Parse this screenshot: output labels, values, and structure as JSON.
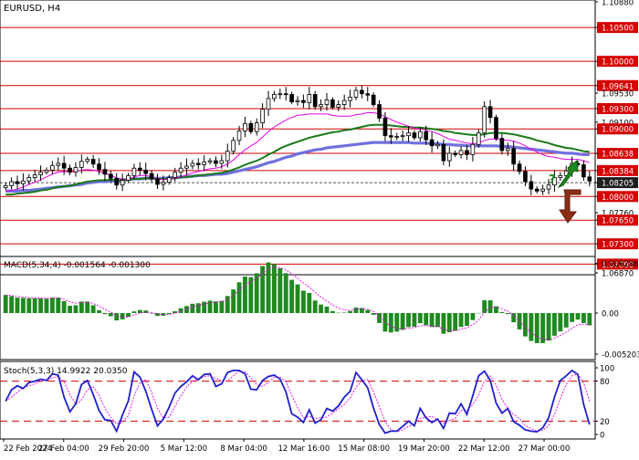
{
  "chart_data": {
    "type": "candlestick",
    "symbol_label": "EURUSD, H4",
    "price_axis": {
      "min": 1.0687,
      "max": 1.1088,
      "tick_labels": [
        "1.10880",
        "1.10500",
        "1.10000",
        "1.09641",
        "1.09530",
        "1.09300",
        "1.09100",
        "1.09000",
        "1.08638",
        "1.08384",
        "1.08205",
        "1.08000",
        "1.07760",
        "1.07650",
        "1.07300",
        "1.07000",
        "1.06870"
      ],
      "tick_values": [
        1.1088,
        1.105,
        1.1,
        1.09641,
        1.0953,
        1.093,
        1.091,
        1.09,
        1.08638,
        1.08384,
        1.08205,
        1.08,
        1.0776,
        1.0765,
        1.073,
        1.07,
        1.0687
      ],
      "highlight_colors": {
        "1.10500": "#d40000",
        "1.10000": "#d40000",
        "1.09641": "#d40000",
        "1.09300": "#d40000",
        "1.09000": "#d40000",
        "1.08638": "#d40000",
        "1.08384": "#d40000",
        "1.08205": "#1e1e1e",
        "1.08000": "#d40000",
        "1.07650": "#d40000",
        "1.07300": "#d40000",
        "1.07000": "#d40000"
      }
    },
    "horizontal_levels": [
      1.105,
      1.1,
      1.09641,
      1.093,
      1.09,
      1.08638,
      1.08384,
      1.08,
      1.0765,
      1.073,
      1.07
    ],
    "current_price": 1.08205,
    "time_labels": [
      "22 Feb 2024",
      "27 Feb 04:00",
      "29 Feb 20:00",
      "5 Mar 12:00",
      "8 Mar 04:00",
      "12 Mar 16:00",
      "15 Mar 08:00",
      "19 Mar 20:00",
      "22 Mar 12:00",
      "27 Mar 00:00"
    ],
    "closes": [
      1.0816,
      1.0822,
      1.0819,
      1.0823,
      1.0828,
      1.0832,
      1.0836,
      1.0839,
      1.0846,
      1.0849,
      1.0842,
      1.0836,
      1.0843,
      1.0852,
      1.0855,
      1.0848,
      1.084,
      1.0833,
      1.0827,
      1.0817,
      1.0824,
      1.0831,
      1.0842,
      1.0839,
      1.0834,
      1.0826,
      1.0818,
      1.0821,
      1.0828,
      1.0836,
      1.0842,
      1.0845,
      1.0849,
      1.0847,
      1.0851,
      1.0853,
      1.0849,
      1.0853,
      1.0867,
      1.0883,
      1.0897,
      1.0908,
      1.0896,
      1.0909,
      1.0929,
      1.0945,
      1.0951,
      1.0952,
      1.0951,
      1.094,
      1.0942,
      1.0939,
      1.0951,
      1.0933,
      1.0936,
      1.0943,
      1.0932,
      1.0936,
      1.0942,
      1.0947,
      1.0957,
      1.0952,
      1.095,
      1.0936,
      1.0916,
      1.089,
      1.0888,
      1.0889,
      1.089,
      1.0894,
      1.0887,
      1.0896,
      1.0884,
      1.0875,
      1.0877,
      1.0853,
      1.0864,
      1.0862,
      1.0868,
      1.0862,
      1.0877,
      1.0894,
      1.0933,
      1.0917,
      1.0886,
      1.0868,
      1.0871,
      1.0848,
      1.0837,
      1.0822,
      1.0811,
      1.0808,
      1.0811,
      1.0817,
      1.0828,
      1.0831,
      1.0838,
      1.0849,
      1.0847,
      1.0829,
      1.0823
    ],
    "indicator_lines": {
      "magenta": [
        1.0808,
        1.0809,
        1.0811,
        1.0814,
        1.0818,
        1.0821,
        1.0825,
        1.0829,
        1.0833,
        1.0836,
        1.0837,
        1.0836,
        1.0837,
        1.0839,
        1.084,
        1.0839,
        1.0837,
        1.0834,
        1.0832,
        1.0827,
        1.0826,
        1.0826,
        1.0829,
        1.0831,
        1.0831,
        1.0829,
        1.0826,
        1.0825,
        1.0825,
        1.0827,
        1.0829,
        1.0832,
        1.0835,
        1.0837,
        1.0839,
        1.0841,
        1.0842,
        1.0844,
        1.0848,
        1.0854,
        1.0862,
        1.0869,
        1.0875,
        1.088,
        1.0888,
        1.0896,
        1.0903,
        1.0908,
        1.0913,
        1.0917,
        1.092,
        1.0921,
        1.0922,
        1.0922,
        1.0922,
        1.0922,
        1.092,
        1.0919,
        1.0919,
        1.0919,
        1.0921,
        1.0922,
        1.0924,
        1.0924,
        1.0922,
        1.0918,
        1.0914,
        1.091,
        1.0907,
        1.0904,
        1.0901,
        1.09,
        1.0898,
        1.0896,
        1.0893,
        1.0889,
        1.0885,
        1.0883,
        1.0881,
        1.0879,
        1.0878,
        1.0879,
        1.0883,
        1.0885,
        1.0885,
        1.0884,
        1.0883,
        1.0882,
        1.0879,
        1.0875,
        1.087,
        1.0866,
        1.0862,
        1.0859,
        1.0858,
        1.0856,
        1.0855,
        1.0855,
        1.0855,
        1.0853,
        1.085
      ],
      "green": [
        1.0803,
        1.0803,
        1.0804,
        1.0805,
        1.0806,
        1.0807,
        1.0809,
        1.081,
        1.0812,
        1.0814,
        1.0815,
        1.0816,
        1.0818,
        1.082,
        1.0822,
        1.0823,
        1.0824,
        1.0824,
        1.0825,
        1.0824,
        1.0824,
        1.0825,
        1.0826,
        1.0826,
        1.0827,
        1.0827,
        1.0826,
        1.0826,
        1.0826,
        1.0827,
        1.0828,
        1.0829,
        1.083,
        1.0831,
        1.0832,
        1.0833,
        1.0834,
        1.0835,
        1.0837,
        1.084,
        1.0843,
        1.0847,
        1.085,
        1.0853,
        1.0857,
        1.0862,
        1.0866,
        1.0871,
        1.0875,
        1.0878,
        1.0881,
        1.0884,
        1.0887,
        1.0889,
        1.0891,
        1.0893,
        1.0895,
        1.0896,
        1.0898,
        1.0899,
        1.0901,
        1.0903,
        1.0905,
        1.0906,
        1.0906,
        1.0906,
        1.0905,
        1.0904,
        1.0903,
        1.0903,
        1.0902,
        1.0902,
        1.0901,
        1.09,
        1.0899,
        1.0897,
        1.0896,
        1.0894,
        1.0893,
        1.0892,
        1.0891,
        1.0891,
        1.0892,
        1.0894,
        1.0894,
        1.0894,
        1.0893,
        1.0892,
        1.089,
        1.0888,
        1.0886,
        1.0883,
        1.0881,
        1.0879,
        1.0876,
        1.0874,
        1.0872,
        1.0871,
        1.0869,
        1.0867,
        1.0866
      ],
      "blue": [
        1.0808,
        1.0808,
        1.0808,
        1.0809,
        1.0809,
        1.081,
        1.0811,
        1.0812,
        1.0813,
        1.0814,
        1.0815,
        1.0816,
        1.0817,
        1.0818,
        1.082,
        1.0821,
        1.0822,
        1.0822,
        1.0823,
        1.0823,
        1.0824,
        1.0825,
        1.0826,
        1.0826,
        1.0827,
        1.0827,
        1.0827,
        1.0827,
        1.0828,
        1.0828,
        1.0829,
        1.0829,
        1.083,
        1.0831,
        1.0831,
        1.0832,
        1.0833,
        1.0833,
        1.0834,
        1.0836,
        1.0838,
        1.084,
        1.0842,
        1.0844,
        1.0847,
        1.085,
        1.0852,
        1.0855,
        1.0858,
        1.086,
        1.0863,
        1.0865,
        1.0867,
        1.0869,
        1.087,
        1.0872,
        1.0873,
        1.0874,
        1.0875,
        1.0876,
        1.0877,
        1.0878,
        1.0879,
        1.088,
        1.088,
        1.088,
        1.088,
        1.088,
        1.088,
        1.088,
        1.0879,
        1.0879,
        1.0879,
        1.0878,
        1.0878,
        1.0877,
        1.0877,
        1.0876,
        1.0876,
        1.0875,
        1.0875,
        1.0875,
        1.0875,
        1.0875,
        1.0875,
        1.0874,
        1.0874,
        1.0873,
        1.0872,
        1.0871,
        1.087,
        1.0869,
        1.0868,
        1.0867,
        1.0866,
        1.0865,
        1.0864,
        1.0864,
        1.0863,
        1.0862,
        1.0862
      ]
    },
    "macd": {
      "label": "MACD(5,34,4) -0.001564 -0.001300",
      "axis_labels": [
        "0.006286",
        "0.00",
        "-0.005203"
      ],
      "axis_values": [
        0.006286,
        0,
        -0.005203
      ],
      "histogram": [
        0.00229,
        0.00214,
        0.00196,
        0.00192,
        0.00187,
        0.00186,
        0.00186,
        0.00183,
        0.00196,
        0.00195,
        0.00151,
        0.00093,
        0.00099,
        0.00145,
        0.00146,
        0.00099,
        0.00035,
        -0.00014,
        -0.00041,
        -0.00093,
        -0.0008,
        -0.00048,
        0.00021,
        0.00039,
        0.00033,
        1e-05,
        -0.00037,
        -0.00034,
        -0.00012,
        0.00023,
        0.00061,
        0.00089,
        0.00118,
        0.00124,
        0.00143,
        0.00158,
        0.00148,
        0.00154,
        0.00216,
        0.00299,
        0.0039,
        0.00462,
        0.00456,
        0.00504,
        0.00596,
        0.00641,
        0.0062,
        0.00567,
        0.00505,
        0.00421,
        0.00363,
        0.00284,
        0.00255,
        0.00159,
        0.00108,
        0.00082,
        0.00025,
        4e-05,
        6e-05,
        0.00025,
        0.0007,
        0.00064,
        0.00038,
        -0.00022,
        -0.00126,
        -0.00235,
        -0.00245,
        -0.00235,
        -0.00213,
        -0.00178,
        -0.00173,
        -0.00128,
        -0.00153,
        -0.00177,
        -0.00177,
        -0.00262,
        -0.00243,
        -0.00225,
        -0.00176,
        -0.00162,
        -0.00089,
        1e-05,
        0.00162,
        0.00161,
        0.00086,
        0.00013,
        -0.00013,
        -0.00117,
        -0.00207,
        -0.00296,
        -0.00353,
        -0.00381,
        -0.00381,
        -0.00348,
        -0.00287,
        -0.00233,
        -0.00183,
        -0.00113,
        -0.00083,
        -0.00126,
        -0.00156
      ],
      "signal": [
        0.00229,
        0.00222,
        0.0021,
        0.00202,
        0.00196,
        0.00192,
        0.0019,
        0.00187,
        0.0019,
        0.00192,
        0.00175,
        0.00142,
        0.00125,
        0.00133,
        0.00138,
        0.00123,
        0.00088,
        0.00047,
        0.00012,
        -0.0003,
        -0.00051,
        -0.0005,
        -0.00022,
        0,
        0.00013,
        8e-05,
        -0.0001,
        -0.0002,
        -0.00017,
        -1e-05,
        0.00024,
        0.0005,
        0.00077,
        0.00096,
        0.00115,
        0.00132,
        0.00139,
        0.00145,
        0.00173,
        0.00223,
        0.0029,
        0.00359,
        0.00398,
        0.00441,
        0.00503,
        0.00558,
        0.00583,
        0.00577,
        0.00548,
        0.00497,
        0.00443,
        0.00379,
        0.0033,
        0.00262,
        0.002,
        0.00153,
        0.00102,
        0.00063,
        0.0004,
        0.00034,
        0.00048,
        0.00054,
        0.00048,
        0.0002,
        -0.00038,
        -0.00117,
        -0.00168,
        -0.00195,
        -0.00202,
        -0.00192,
        -0.00185,
        -0.00162,
        -0.00158,
        -0.00166,
        -0.0017,
        -0.00207,
        -0.00221,
        -0.00223,
        -0.00204,
        -0.00187,
        -0.00148,
        -0.00088,
        0.00012,
        0.00072,
        0.00077,
        0.00052,
        0.00026,
        -0.00031,
        -0.00101,
        -0.00179,
        -0.00249,
        -0.00302,
        -0.00334,
        -0.00339,
        -0.00318,
        -0.00284,
        -0.00243,
        -0.00191,
        -0.00148,
        -0.0014,
        -0.00146
      ]
    },
    "stochastic": {
      "label": "Stoch(5,3,3) 14.9922 20.0350",
      "axis_labels": [
        "100",
        "80",
        "20",
        "0"
      ],
      "axis_values": [
        100,
        80,
        20,
        0
      ],
      "main": [
        50,
        67,
        73,
        69,
        78,
        80,
        83,
        81,
        91,
        89,
        56,
        34,
        46,
        75,
        81,
        60,
        36,
        22,
        21,
        5,
        29,
        50,
        94,
        86,
        65,
        38,
        13,
        23,
        41,
        62,
        72,
        79,
        88,
        82,
        90,
        91,
        72,
        76,
        93,
        96,
        96,
        91,
        68,
        67,
        81,
        87,
        89,
        83,
        64,
        31,
        26,
        18,
        37,
        17,
        22,
        39,
        35,
        43,
        56,
        65,
        93,
        82,
        70,
        40,
        15,
        2,
        5,
        5,
        12,
        20,
        13,
        39,
        25,
        18,
        23,
        9,
        32,
        31,
        46,
        30,
        58,
        88,
        95,
        81,
        47,
        32,
        39,
        19,
        14,
        7,
        5,
        4,
        10,
        25,
        56,
        81,
        88,
        96,
        90,
        45,
        15
      ],
      "signal": [
        50,
        56,
        63,
        70,
        73,
        76,
        80,
        81,
        85,
        87,
        79,
        60,
        45,
        52,
        67,
        72,
        59,
        39,
        26,
        16,
        18,
        28,
        58,
        77,
        82,
        63,
        39,
        25,
        26,
        42,
        58,
        71,
        80,
        83,
        87,
        88,
        84,
        80,
        80,
        88,
        95,
        94,
        85,
        75,
        72,
        78,
        86,
        86,
        79,
        59,
        40,
        25,
        27,
        24,
        25,
        26,
        32,
        39,
        45,
        55,
        71,
        80,
        82,
        64,
        42,
        19,
        7,
        4,
        7,
        12,
        15,
        24,
        26,
        27,
        22,
        17,
        21,
        24,
        36,
        36,
        45,
        59,
        80,
        88,
        74,
        53,
        39,
        30,
        24,
        13,
        9,
        5,
        6,
        13,
        30,
        54,
        75,
        88,
        91,
        77,
        50
      ]
    },
    "signals": {
      "up_arrow_label": "?",
      "up_color": "#1f8a1f",
      "down_color": "#8b2e16"
    }
  },
  "colors": {
    "bullish_body": "#ffffff",
    "candle_outline": "#000000",
    "resistance": "#d40000",
    "current_price_line": "#1e1e1e",
    "macd_bar": "#1f8a1f",
    "macd_signal": "#e600e6",
    "stoch_main": "#2020cc",
    "stoch_signal": "#e600e6",
    "ma_magenta": "#e600e6",
    "ma_green": "#1a7a1a",
    "ma_blue": "#7070e0"
  }
}
